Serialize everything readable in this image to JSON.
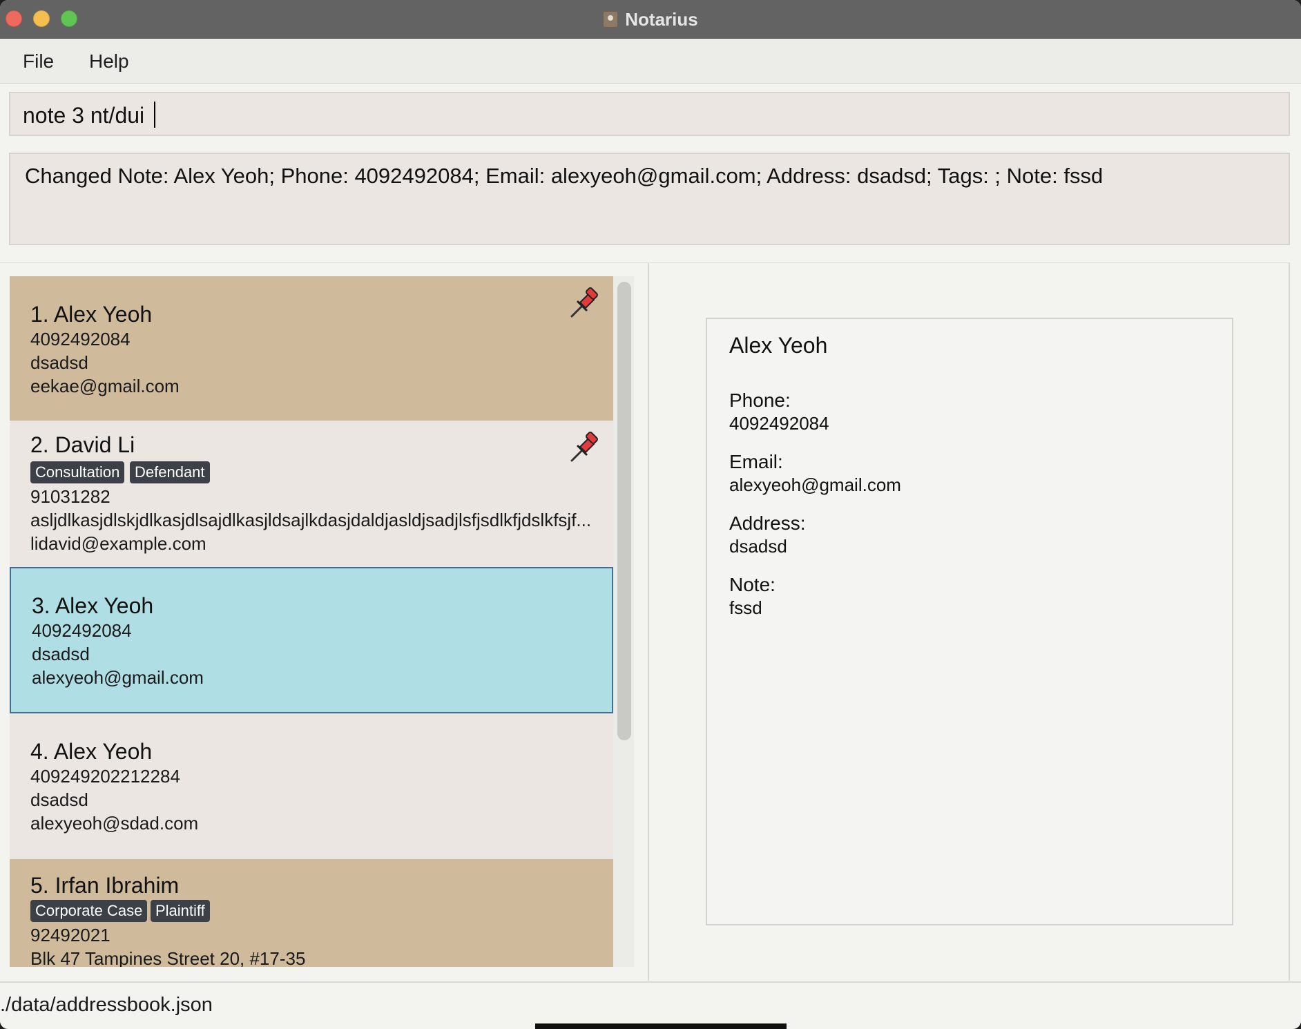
{
  "window": {
    "title": "Notarius"
  },
  "menu": {
    "items": [
      "File",
      "Help"
    ]
  },
  "command": {
    "value": "note 3 nt/dui"
  },
  "result": {
    "text": "Changed Note: Alex Yeoh; Phone: 4092492084; Email: alexyeoh@gmail.com; Address: dsadsd; Tags: ; Note: fssd"
  },
  "contacts": [
    {
      "name": "1. Alex Yeoh",
      "pinned": true,
      "tags": [],
      "phone": "4092492084",
      "address": "dsadsd",
      "email": "eekae@gmail.com"
    },
    {
      "name": "2. David Li",
      "pinned": true,
      "tags": [
        "Consultation",
        "Defendant"
      ],
      "phone": "91031282",
      "address": "asljdlkasjdlskjdlkasjdlsajdlkasjldsajlkdasjdaldjasldjsadjlsfjsdlkfjdslkfsjf...",
      "email": "lidavid@example.com"
    },
    {
      "name": "3. Alex Yeoh",
      "pinned": false,
      "selected": true,
      "tags": [],
      "phone": "4092492084",
      "address": "dsadsd",
      "email": "alexyeoh@gmail.com"
    },
    {
      "name": "4. Alex Yeoh",
      "pinned": false,
      "tags": [],
      "phone": "409249202212284",
      "address": "dsadsd",
      "email": "alexyeoh@sdad.com"
    },
    {
      "name": "5. Irfan Ibrahim",
      "pinned": true,
      "tags": [
        "Corporate Case",
        "Plaintiff"
      ],
      "phone": "92492021",
      "address": "Blk 47 Tampines Street 20, #17-35",
      "email": ""
    }
  ],
  "detail": {
    "name": "Alex Yeoh",
    "phone_label": "Phone:",
    "phone": "4092492084",
    "email_label": "Email:",
    "email": "alexyeoh@gmail.com",
    "address_label": "Address:",
    "address": "dsadsd",
    "note_label": "Note:",
    "note": "fssd"
  },
  "status": {
    "path": "./data/addressbook.json"
  },
  "colors": {
    "pinned_card": "#cfbb9c",
    "plain_card": "#ece6e2",
    "selected_card": "#afdee5",
    "tag_bg": "#3c4147"
  }
}
